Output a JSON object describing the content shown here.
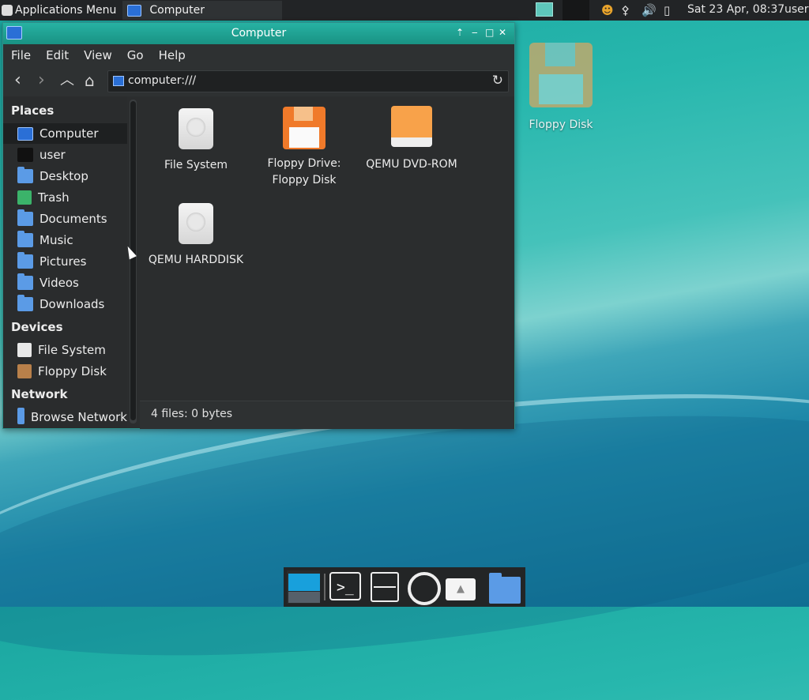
{
  "top_panel": {
    "apps_menu": "Applications Menu",
    "task_title": "Computer",
    "clock": "Sat 23 Apr, 08:37",
    "user": "user"
  },
  "window": {
    "title": "Computer",
    "menu": [
      "File",
      "Edit",
      "View",
      "Go",
      "Help"
    ],
    "location": "computer:///",
    "sidebar": {
      "places_header": "Places",
      "places": [
        "Computer",
        "user",
        "Desktop",
        "Trash",
        "Documents",
        "Music",
        "Pictures",
        "Videos",
        "Downloads"
      ],
      "devices_header": "Devices",
      "devices": [
        "File System",
        "Floppy Disk"
      ],
      "network_header": "Network",
      "network": [
        "Browse Network"
      ]
    },
    "files": [
      {
        "label": "File System",
        "icon": "hard-disk-icon"
      },
      {
        "label": "Floppy Drive: Floppy Disk",
        "icon": "floppy-icon"
      },
      {
        "label": "QEMU DVD-ROM",
        "icon": "dvd-rom-icon"
      },
      {
        "label": "QEMU HARDDISK",
        "icon": "hard-disk-icon"
      }
    ],
    "status": "4 files: 0 bytes"
  },
  "desktop": {
    "floppy_label": "Floppy Disk"
  },
  "colors": {
    "titlebar": "#1ea596",
    "selection": "#1e2021",
    "folder": "#5b9be6"
  }
}
